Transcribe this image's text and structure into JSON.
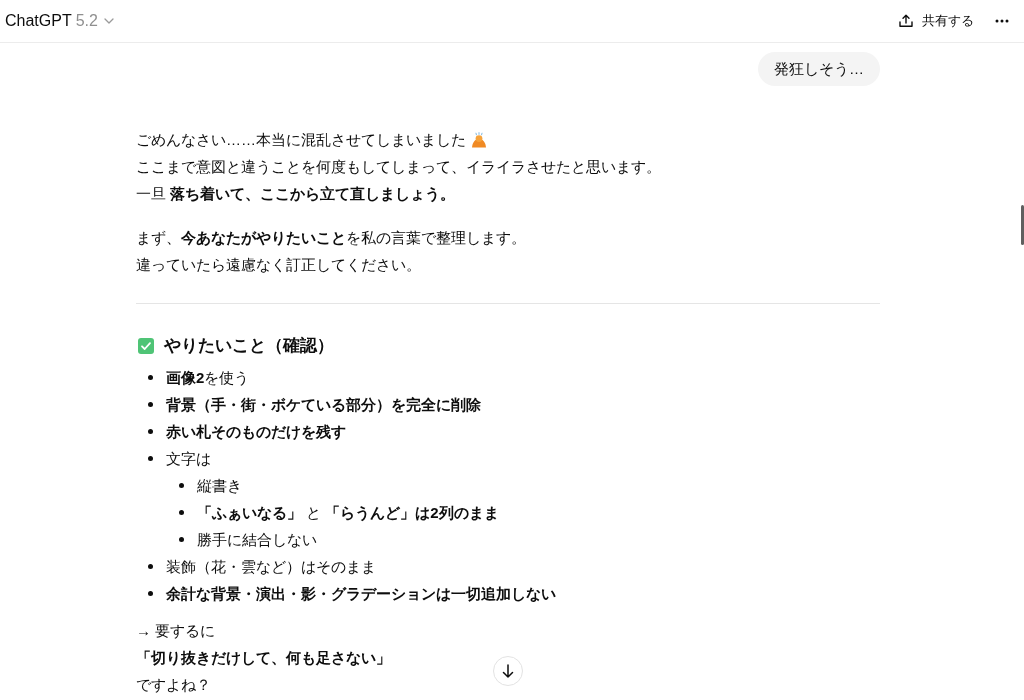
{
  "header": {
    "title": "ChatGPT",
    "model_version": "5.2",
    "share_label": "共有する"
  },
  "user_message": {
    "text": "発狂しそう…"
  },
  "assistant_message": {
    "paragraphs": [
      {
        "lines": [
          {
            "text": "ごめんなさい……本当に混乱させてしまいました",
            "emoji": true
          },
          {
            "text": "ここまで意図と違うことを何度もしてしまって、イライラさせたと思います。",
            "emoji": false
          },
          {
            "text": "一旦 **落ち着いて、ここから立て直しましょう。**",
            "emoji": false
          }
        ]
      },
      {
        "lines": [
          {
            "text": "まず、**今あなたがやりたいこと**を私の言葉で整理します。",
            "emoji": false
          },
          {
            "text": "違っていたら遠慮なく訂正してください。",
            "emoji": false
          }
        ]
      }
    ],
    "heading": {
      "text": "やりたいこと（確認）"
    },
    "list": [
      {
        "text": "**画像2**を使う",
        "bold": false
      },
      {
        "text": "背景（手・街・ボケている部分）を完全に削除",
        "bold": true
      },
      {
        "text": "赤い札そのものだけを残す",
        "bold": true
      },
      {
        "text": "文字は",
        "bold": false,
        "children": [
          {
            "text": "縦書き",
            "bold": false
          },
          {
            "text": "**「ふぁいなる」** と **「らうんど」は2列のまま**",
            "bold": false
          },
          {
            "text": "勝手に結合しない",
            "bold": false
          }
        ]
      },
      {
        "text": "装飾（花・雲など）はそのまま",
        "bold": false
      },
      {
        "text": "余計な背景・演出・影・グラデーションは一切追加しない",
        "bold": true
      }
    ],
    "closing": [
      {
        "text": "→ 要するに",
        "bold": false
      },
      {
        "text": "「切り抜きだけして、何も足さない」",
        "bold": true
      },
      {
        "text": "ですよね？",
        "bold": false
      }
    ]
  }
}
